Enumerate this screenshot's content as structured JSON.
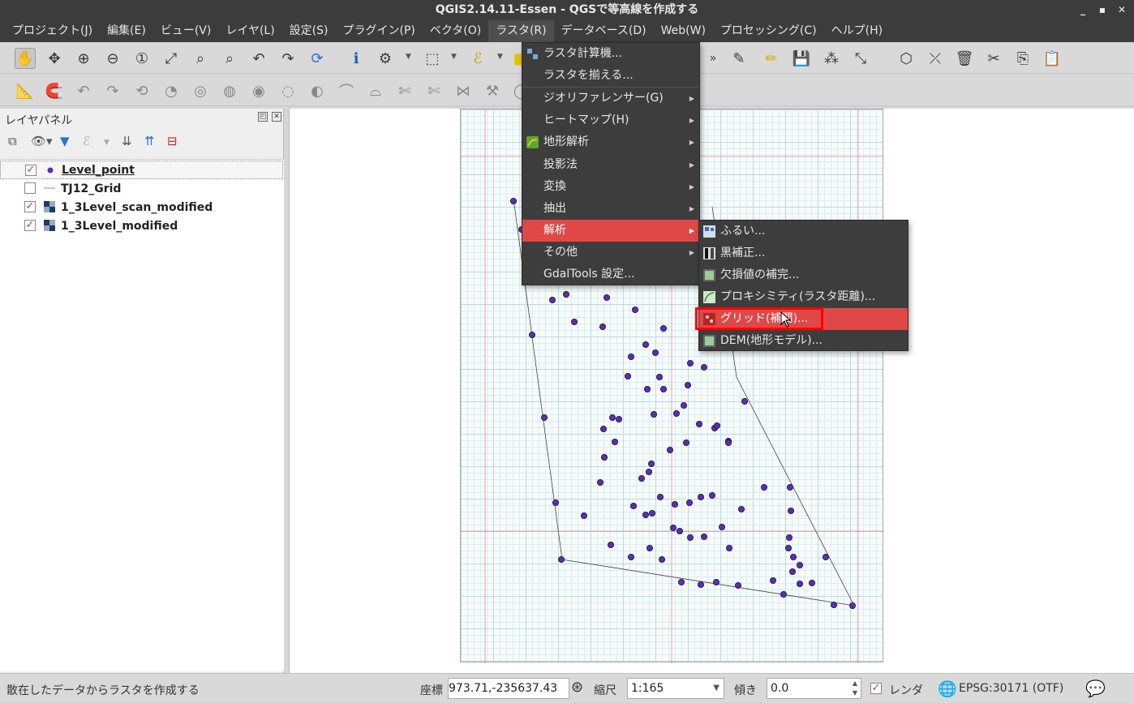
{
  "window": {
    "title": "QGIS2.14.11-Essen - QGSで等高線を作成する",
    "controls": [
      "_",
      "▪",
      "✕"
    ]
  },
  "menubar": [
    "プロジェクト(J)",
    "編集(E)",
    "ビュー(V)",
    "レイヤ(L)",
    "設定(S)",
    "プラグイン(P)",
    "ベクタ(O)",
    "ラスタ(R)",
    "データベース(D)",
    "Web(W)",
    "プロセッシング(C)",
    "ヘルプ(H)"
  ],
  "raster_menu": {
    "items": [
      {
        "label": "ラスタ計算機...",
        "submenu": false,
        "icon": "raster-calculator-icon"
      },
      {
        "label": "ラスタを揃える...",
        "submenu": false,
        "icon": ""
      },
      {
        "label": "ジオリファレンサー(G)",
        "submenu": true,
        "icon": ""
      },
      {
        "label": "ヒートマップ(H)",
        "submenu": true,
        "icon": ""
      },
      {
        "label": "地形解析",
        "submenu": true,
        "icon": "terrain-analysis-icon"
      },
      {
        "label": "投影法",
        "submenu": true,
        "icon": ""
      },
      {
        "label": "変換",
        "submenu": true,
        "icon": ""
      },
      {
        "label": "抽出",
        "submenu": true,
        "icon": ""
      },
      {
        "label": "解析",
        "submenu": true,
        "icon": "",
        "highlighted": true
      },
      {
        "label": "その他",
        "submenu": true,
        "icon": ""
      },
      {
        "label": "GdalTools 設定...",
        "submenu": false,
        "icon": ""
      }
    ]
  },
  "analysis_submenu": {
    "items": [
      {
        "label": "ふるい...",
        "icon": "sieve-icon"
      },
      {
        "label": "黒補正...",
        "icon": "near-black-icon"
      },
      {
        "label": "欠損値の補完...",
        "icon": "fill-nodata-icon"
      },
      {
        "label": "プロキシミティ(ラスタ距離)...",
        "icon": "proximity-icon"
      },
      {
        "label": "グリッド(補間)...",
        "icon": "grid-interpolation-icon",
        "highlighted": true
      },
      {
        "label": "DEM(地形モデル)...",
        "icon": "dem-icon"
      }
    ]
  },
  "layer_panel": {
    "title": "レイヤパネル",
    "layers": [
      {
        "name": "Level_point",
        "checked": true,
        "symbol": "point",
        "selected": true
      },
      {
        "name": "TJ12_Grid",
        "checked": false,
        "symbol": "line",
        "selected": false
      },
      {
        "name": "1_3Level_scan_modified",
        "checked": true,
        "symbol": "raster",
        "selected": false
      },
      {
        "name": "1_3Level_modified",
        "checked": true,
        "symbol": "raster",
        "selected": false
      }
    ]
  },
  "statusbar": {
    "message": "散在したデータからラスタを作成する",
    "coord_label": "座標",
    "coord_value": "973.71,-235637.43",
    "scale_label": "縮尺",
    "scale_value": "1:165",
    "rotation_label": "傾き",
    "rotation_value": "0.0",
    "render_label": "レンダ",
    "render_checked": true,
    "crs": "EPSG:30171 (OTF)"
  },
  "colors": {
    "menu_bg": "#3d3d3d",
    "highlight": "#e04848",
    "callout": "#ff0000",
    "point_fill": "#5a2fb0"
  }
}
